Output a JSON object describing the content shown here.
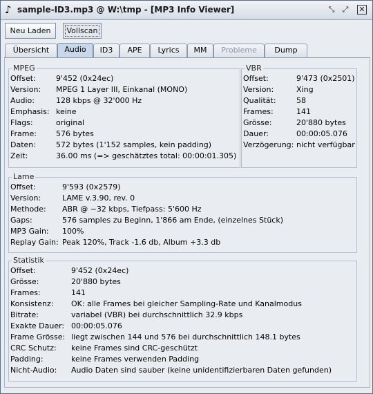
{
  "window": {
    "title": "sample-ID3.mp3 @ W:\\tmp - [MP3 Info Viewer]",
    "controls": [
      "minimize-icon",
      "maximize-icon",
      "close-icon"
    ]
  },
  "toolbar": {
    "reload_label": "Neu Laden",
    "fullscan_label": "Vollscan"
  },
  "tabs": [
    {
      "label": "Übersicht"
    },
    {
      "label": "Audio",
      "active": true
    },
    {
      "label": "ID3"
    },
    {
      "label": "APE"
    },
    {
      "label": "Lyrics"
    },
    {
      "label": "MM"
    },
    {
      "label": "Probleme",
      "disabled": true
    },
    {
      "label": "Dump"
    }
  ],
  "mpeg": {
    "title": "MPEG",
    "rows": [
      {
        "label": "Offset:",
        "value": "9'452 (0x24ec)"
      },
      {
        "label": "Version:",
        "value": "MPEG 1 Layer III, Einkanal (MONO)"
      },
      {
        "label": "Audio:",
        "value": "128 kbps @ 32'000 Hz"
      },
      {
        "label": "Emphasis:",
        "value": "keine"
      },
      {
        "label": "Flags:",
        "value": "original"
      },
      {
        "label": "Frame:",
        "value": "576 bytes"
      },
      {
        "label": "Daten:",
        "value": "572 bytes (1'152 samples, kein padding)"
      },
      {
        "label": "Zeit:",
        "value": "36.00 ms (=> geschätztes total: 00:00:01.305)"
      }
    ]
  },
  "vbr": {
    "title": "VBR",
    "rows": [
      {
        "label": "Offset:",
        "value": "9'473 (0x2501)"
      },
      {
        "label": "Version:",
        "value": "Xing"
      },
      {
        "label": "Qualität:",
        "value": "58"
      },
      {
        "label": "Frames:",
        "value": "141"
      },
      {
        "label": "Grösse:",
        "value": "20'880 bytes"
      },
      {
        "label": "Dauer:",
        "value": "00:00:05.076"
      },
      {
        "label": "Verzögerung:",
        "value": "nicht verfügbar"
      }
    ]
  },
  "lame": {
    "title": "Lame",
    "rows": [
      {
        "label": "Offset:",
        "value": "9'593 (0x2579)"
      },
      {
        "label": "Version:",
        "value": "LAME v.3.90, rev. 0"
      },
      {
        "label": "Methode:",
        "value": "ABR @ ~32 kbps, Tiefpass: 5'600 Hz"
      },
      {
        "label": "Gaps:",
        "value": "576 samples zu Beginn, 1'866 am Ende, (einzelnes Stück)"
      },
      {
        "label": "MP3 Gain:",
        "value": "100%"
      },
      {
        "label": "Replay Gain:",
        "value": "Peak 120%, Track -1.6 db, Album +3.3 db"
      }
    ]
  },
  "statistik": {
    "title": "Statistik",
    "rows": [
      {
        "label": "Offset:",
        "value": "9'452 (0x24ec)"
      },
      {
        "label": "Grösse:",
        "value": "20'880 bytes"
      },
      {
        "label": "Frames:",
        "value": "141"
      },
      {
        "label": "Konsistenz:",
        "value": "OK: alle Frames bei gleicher Sampling-Rate und Kanalmodus"
      },
      {
        "label": "Bitrate:",
        "value": "variabel (VBR) bei durchschnittlich 32.9 kbps"
      },
      {
        "label": "Exakte Dauer:",
        "value": "00:00:05.076"
      },
      {
        "label": "Frame Grösse:",
        "value": "liegt zwischen 144 und 576 bei durchschnittlich 148.1 bytes"
      },
      {
        "label": "CRC Schutz:",
        "value": "keine Frames sind CRC-geschützt"
      },
      {
        "label": "Padding:",
        "value": "keine Frames verwenden Padding"
      },
      {
        "label": "Nicht-Audio:",
        "value": "Audio Daten sind sauber (keine unidentifizierbaren Daten gefunden)"
      }
    ]
  }
}
